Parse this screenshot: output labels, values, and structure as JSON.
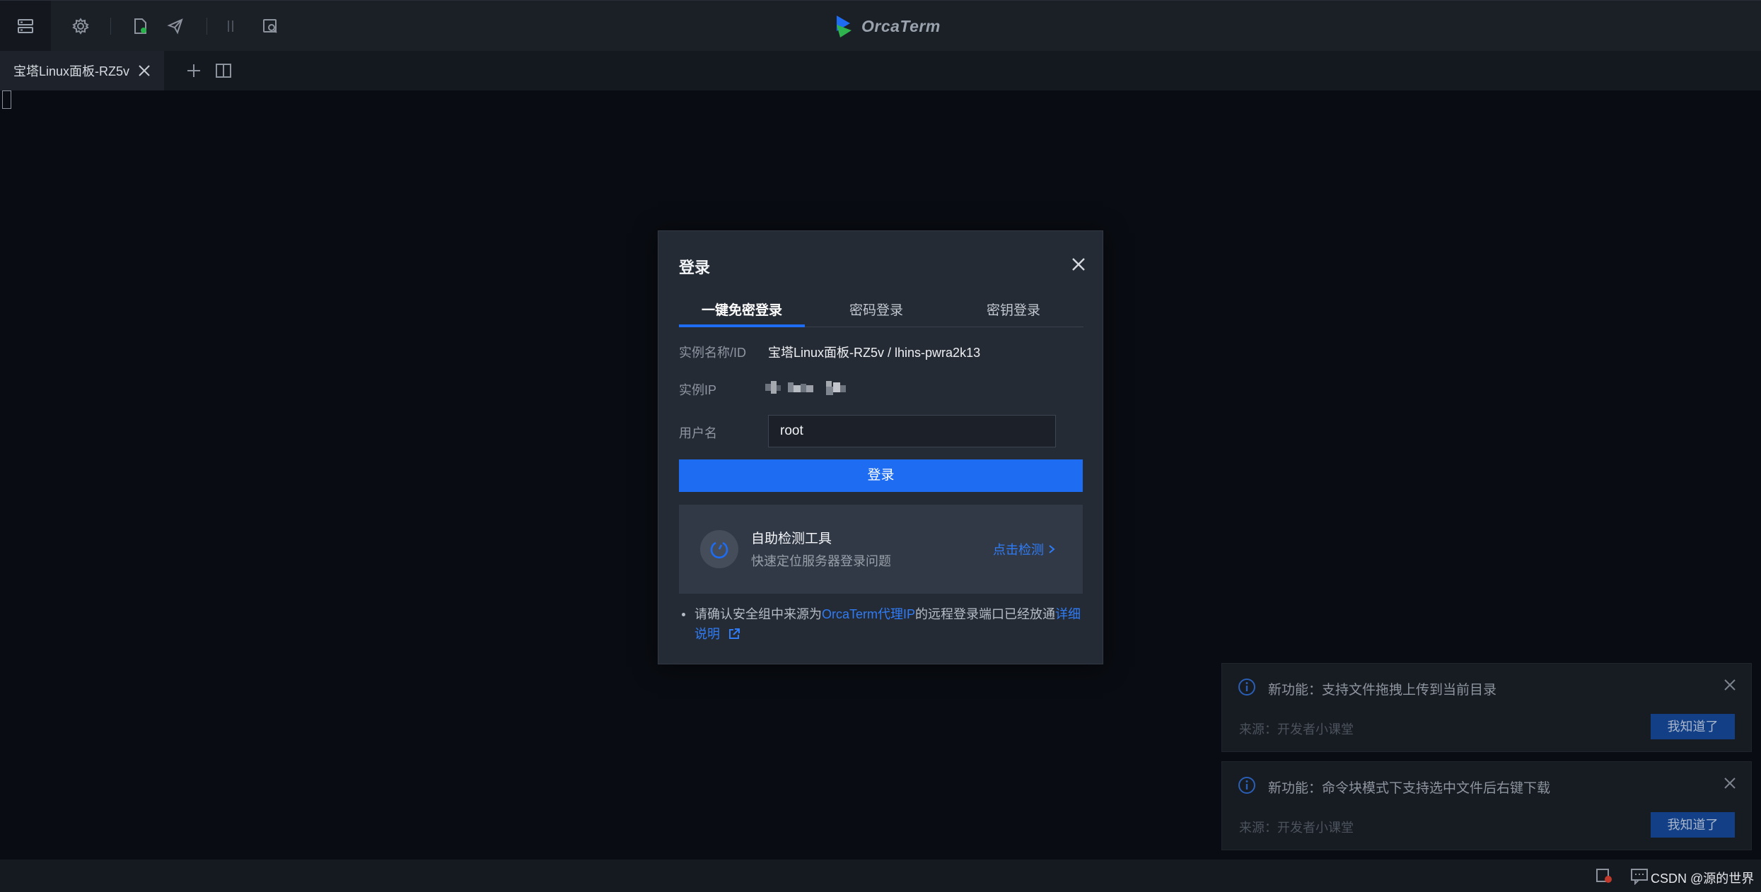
{
  "app": {
    "title": "OrcaTerm"
  },
  "toolbar": {
    "icons": [
      "server-list-icon",
      "settings-icon",
      "file-manager-icon",
      "send-icon",
      "split-icon",
      "search-file-icon"
    ]
  },
  "tabs": [
    {
      "label": "宝塔Linux面板-RZ5v"
    }
  ],
  "dialog": {
    "title": "登录",
    "tabs": [
      "一键免密登录",
      "密码登录",
      "密钥登录"
    ],
    "active_tab": "一键免密登录",
    "instance_label": "实例名称/ID",
    "instance_value": "宝塔Linux面板-RZ5v / lhins-pwra2k13",
    "ip_label": "实例IP",
    "username_label": "用户名",
    "username_value": "root",
    "login_button": "登录",
    "tool": {
      "title": "自助检测工具",
      "desc": "快速定位服务器登录问题",
      "link": "点击检测"
    },
    "note": {
      "part1": "请确认安全组中来源为",
      "link1": "OrcaTerm代理IP",
      "part2": "的远程登录端口已经放通",
      "link2": "详细说明"
    }
  },
  "notifications": [
    {
      "title": "新功能：支持文件拖拽上传到当前目录",
      "source": "来源：开发者小课堂",
      "button": "我知道了"
    },
    {
      "title": "新功能：命令块模式下支持选中文件后右键下载",
      "source": "来源：开发者小课堂",
      "button": "我知道了"
    }
  ],
  "statusbar": {
    "watermark": "CSDN @源的世界"
  },
  "colors": {
    "accent": "#1e6cf1",
    "background": "#0a0d13",
    "dialog": "#252b35"
  }
}
